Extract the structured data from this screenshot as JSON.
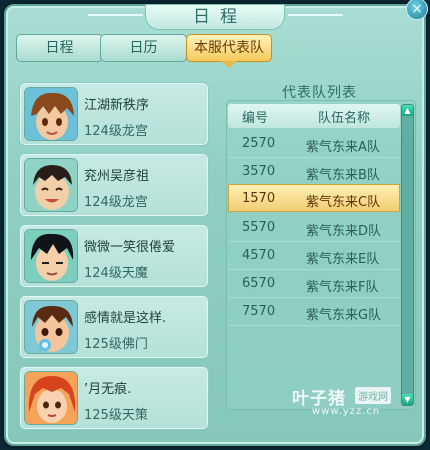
{
  "window": {
    "title": "日程",
    "close_glyph": "×"
  },
  "tabs": [
    {
      "label": "日程",
      "active": false
    },
    {
      "label": "日历",
      "active": false
    },
    {
      "label": "本服代表队",
      "active": true
    }
  ],
  "roster": [
    {
      "name": "江湖新秩序",
      "level": "124级龙宫",
      "avatar": "brown-hair-boy-avatar"
    },
    {
      "name": "兖州吴彦祖",
      "level": "124级龙宫",
      "avatar": "smiling-boy-avatar"
    },
    {
      "name": "微微一笑很倦爱",
      "level": "124级天魔",
      "avatar": "black-hair-boy-avatar"
    },
    {
      "name": "感情就是这样.",
      "level": "125级佛门",
      "avatar": "pacifier-boy-avatar"
    },
    {
      "name": "’月无痕.",
      "level": "125级天策",
      "avatar": "red-hair-girl-avatar"
    }
  ],
  "team_list": {
    "title": "代表队列表",
    "headers": {
      "id": "编号",
      "name": "队伍名称"
    },
    "rows": [
      {
        "id": "2570",
        "name": "紫气东来A队",
        "selected": false
      },
      {
        "id": "3570",
        "name": "紫气东来B队",
        "selected": false
      },
      {
        "id": "1570",
        "name": "紫气东来C队",
        "selected": true
      },
      {
        "id": "5570",
        "name": "紫气东来D队",
        "selected": false
      },
      {
        "id": "4570",
        "name": "紫气东来E队",
        "selected": false
      },
      {
        "id": "6570",
        "name": "紫气东来F队",
        "selected": false
      },
      {
        "id": "7570",
        "name": "紫气东来G队",
        "selected": false
      }
    ]
  },
  "scrollbar": {
    "up_glyph": "▲",
    "down_glyph": "▼"
  },
  "watermark": {
    "main": "叶子猪",
    "tag": "游戏网",
    "url": "www.yzz.cn"
  },
  "colors": {
    "accent_gold": "#f5c95d",
    "panel_teal": "#8fcfc3",
    "text_dark_teal": "#2e6c62"
  }
}
